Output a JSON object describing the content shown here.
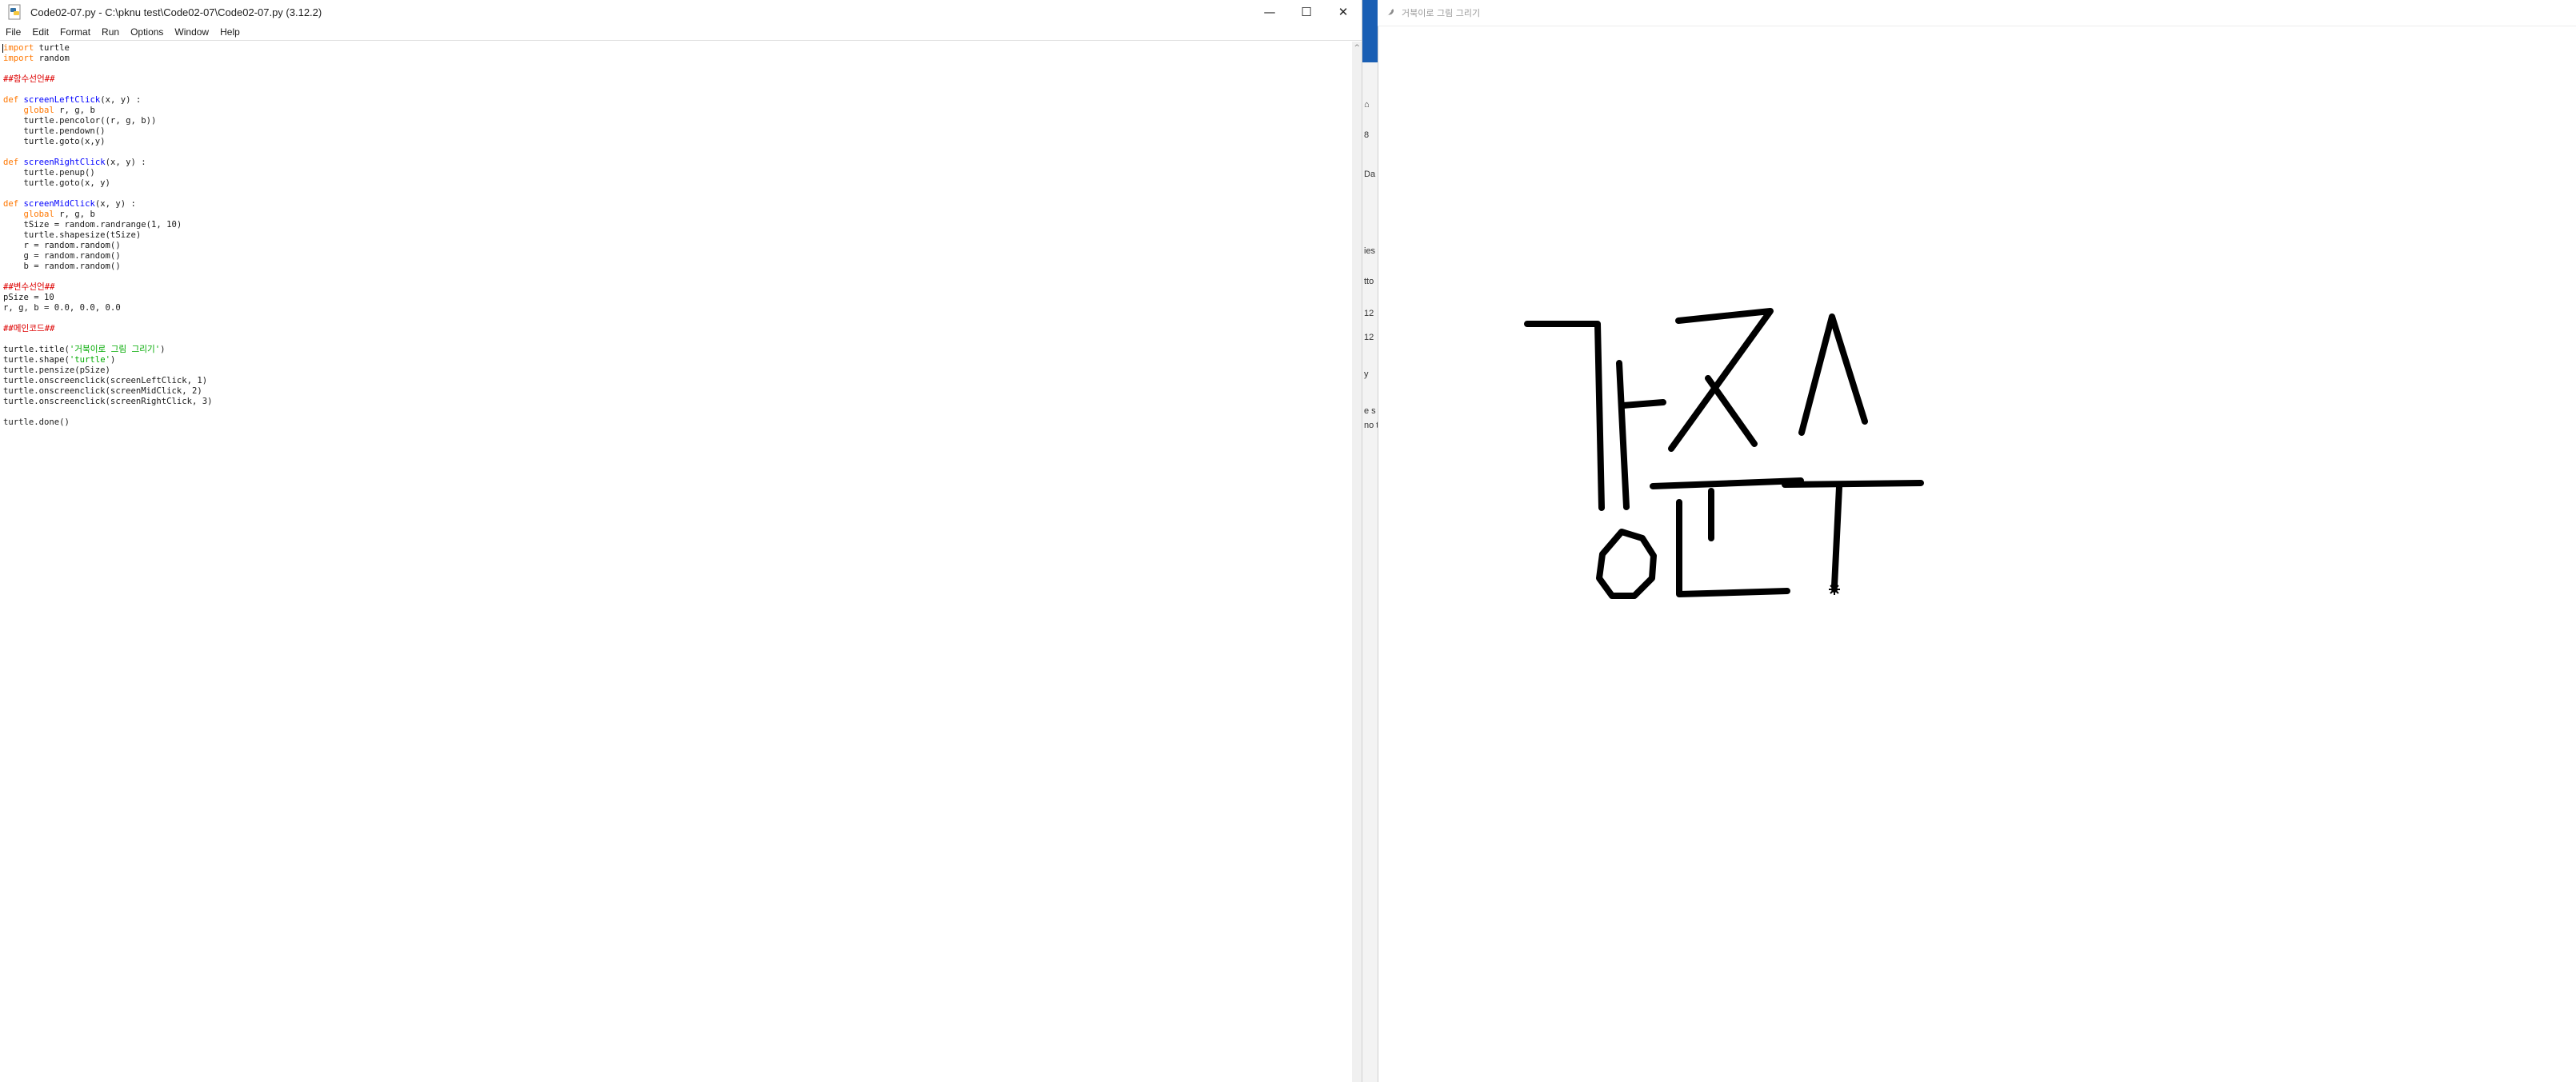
{
  "editor_window": {
    "title": "Code02-07.py - C:\\pknu test\\Code02-07\\Code02-07.py (3.12.2)",
    "controls": {
      "minimize": "—",
      "maximize": "☐",
      "close": "✕"
    },
    "menu": [
      "File",
      "Edit",
      "Format",
      "Run",
      "Options",
      "Window",
      "Help"
    ],
    "code_lines": [
      "import turtle",
      "import random",
      "",
      "##함수선언##",
      "",
      "def screenLeftClick(x, y) :",
      "    global r, g, b",
      "    turtle.pencolor((r, g, b))",
      "    turtle.pendown()",
      "    turtle.goto(x,y)",
      "",
      "def screenRightClick(x, y) :",
      "    turtle.penup()",
      "    turtle.goto(x, y)",
      "",
      "def screenMidClick(x, y) :",
      "    global r, g, b",
      "    tSize = random.randrange(1, 10)",
      "    turtle.shapesize(tSize)",
      "    r = random.random()",
      "    g = random.random()",
      "    b = random.random()",
      "",
      "##변수선언##",
      "pSize = 10",
      "r, g, b = 0.0, 0.0, 0.0",
      "",
      "##메인코드##",
      "",
      "turtle.title('거북이로 그림 그리기')",
      "turtle.shape('turtle')",
      "turtle.pensize(pSize)",
      "turtle.onscreenclick(screenLeftClick, 1)",
      "turtle.onscreenclick(screenMidClick, 2)",
      "turtle.onscreenclick(screenRightClick, 3)",
      "",
      "turtle.done()"
    ]
  },
  "background_window": {
    "fragments": [
      "⌂",
      "8",
      "Da",
      "ies",
      "tto",
      "12",
      "12",
      "y",
      "e s",
      "no t"
    ]
  },
  "turtle_window": {
    "title": "거북이로 그림 그리기",
    "pen_color": "#000000",
    "pen_size": 10
  }
}
